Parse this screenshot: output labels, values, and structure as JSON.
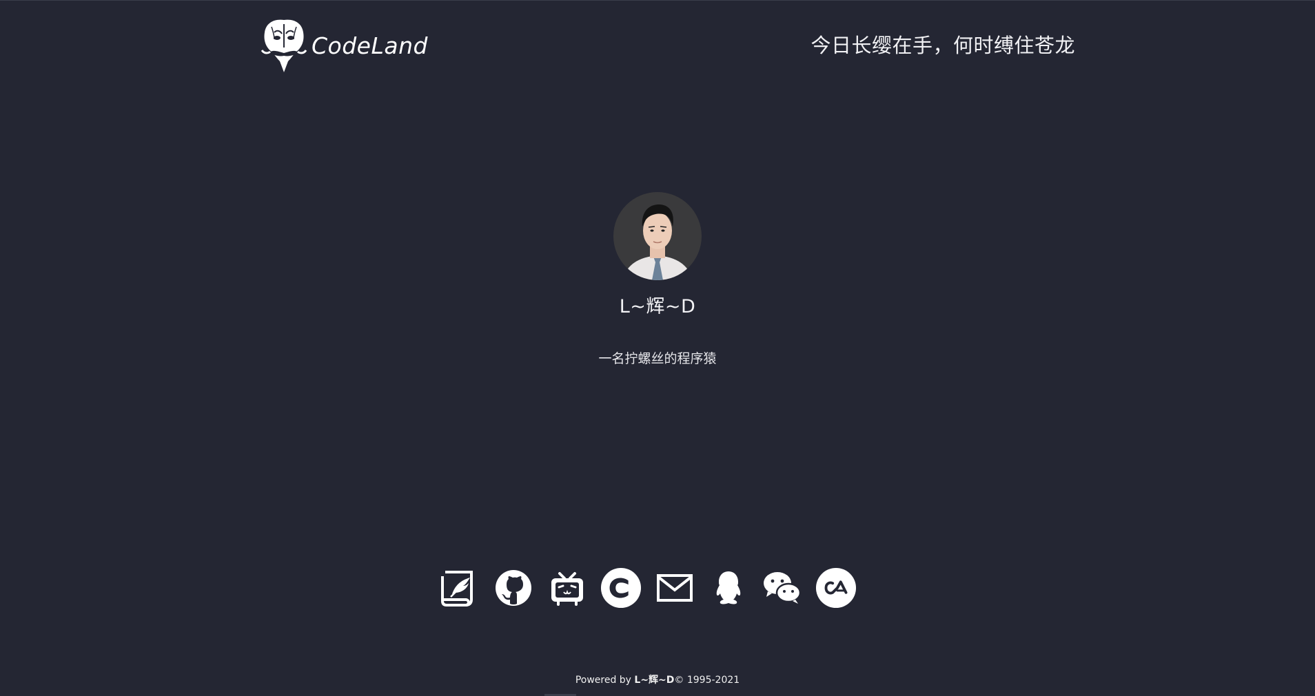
{
  "header": {
    "logo_text": "CodeLand",
    "slogan": "今日长缨在手，何时缚住苍龙"
  },
  "profile": {
    "name": "L~辉~D",
    "bio": "一名拧螺丝的程序猿"
  },
  "social": [
    {
      "name": "blog-icon"
    },
    {
      "name": "github-icon"
    },
    {
      "name": "bilibili-icon"
    },
    {
      "name": "csdn-icon"
    },
    {
      "name": "email-icon"
    },
    {
      "name": "qq-icon"
    },
    {
      "name": "wechat-icon"
    },
    {
      "name": "codewars-icon"
    }
  ],
  "footer": {
    "prefix": "Powered by ",
    "author": "L~辉~D",
    "copyright": "© 1995-2021"
  },
  "colors": {
    "background": "#242633",
    "text": "#ffffff"
  }
}
